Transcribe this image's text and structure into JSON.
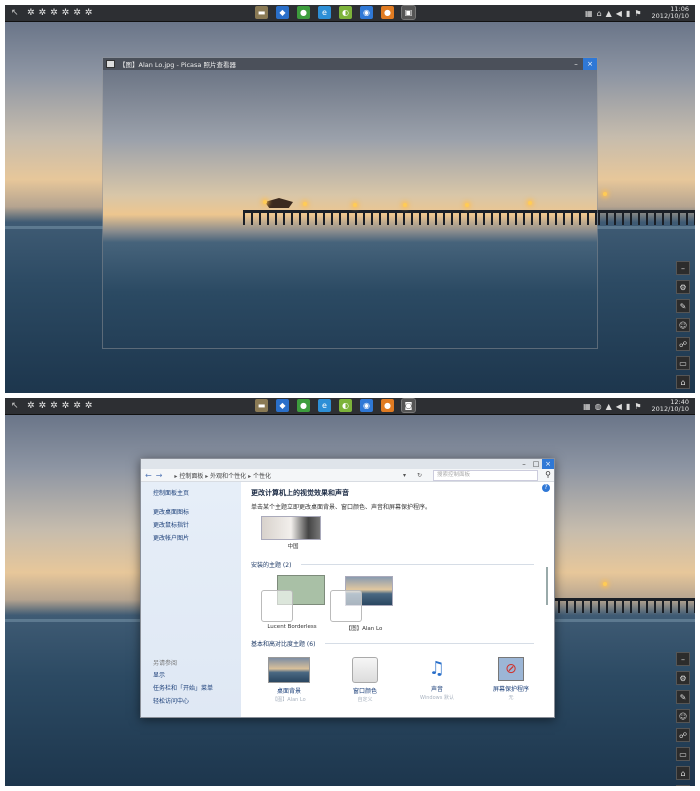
{
  "shot1": {
    "taskbar": {
      "start_icon": "start-icon",
      "clock_time": "11:06",
      "clock_date": "2012/10/10"
    },
    "viewer": {
      "title": "【图】Alan Lo.jpg - Picasa 照片查看器"
    }
  },
  "shot2": {
    "taskbar": {
      "clock_time": "12:40",
      "clock_date": "2012/10/10"
    },
    "control_panel": {
      "breadcrumb": [
        "控制面板",
        "外观和个性化",
        "个性化"
      ],
      "search_placeholder": "搜索控制面板",
      "sidebar": {
        "home": "控制面板主页",
        "links": [
          "更改桌面图标",
          "更改鼠标指针",
          "更改帐户图片"
        ],
        "see_also_head": "另请参阅",
        "see_also": [
          "显示",
          "任务栏和「开始」菜单",
          "轻松访问中心"
        ]
      },
      "main": {
        "title": "更改计算机上的视觉效果和声音",
        "subtitle": "单击某个主题立即更改桌面背景、窗口颜色、声音和屏幕保护程序。",
        "top_theme_label": "中国",
        "installed_head": "安装的主题 (2)",
        "installed_themes": [
          "Lucent Borderless",
          "【图】Alan Lo"
        ],
        "basic_head": "基本和高对比度主题 (6)",
        "bottom": [
          {
            "label": "桌面背景",
            "sub": "【图】Alan Lo"
          },
          {
            "label": "窗口颜色",
            "sub": "自定义"
          },
          {
            "label": "声音",
            "sub": "Windows 默认"
          },
          {
            "label": "屏幕保护程序",
            "sub": "无"
          }
        ]
      }
    }
  },
  "dock_icons": [
    "minimize-icon",
    "settings-icon",
    "pen-icon",
    "people-icon",
    "network-icon",
    "monitor-icon",
    "home-icon",
    "trash-icon"
  ],
  "colors": {
    "taskbar": "#2d2f33",
    "accent": "#2f78d6"
  }
}
